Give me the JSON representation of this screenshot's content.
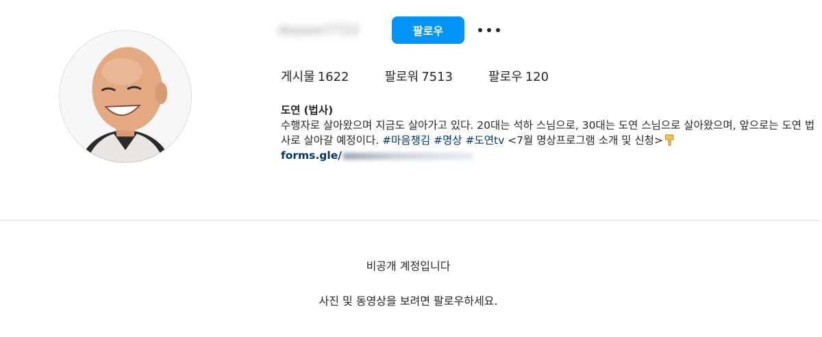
{
  "profile": {
    "username": "doyeon7722",
    "follow_label": "팔로우",
    "more_label": "..."
  },
  "stats": {
    "posts_label": "게시물",
    "posts_value": "1622",
    "followers_label": "팔로워",
    "followers_value": "7513",
    "following_label": "팔로우",
    "following_value": "120"
  },
  "bio": {
    "name": "도연",
    "name_suffix": "(법사)",
    "text_part1": "수행자로 살아왔으며 지금도 살아가고 있다. 20대는 석하 스님으로, 30대는 도연 스님으로 살아왔으며, 앞으로는 도연 법사로 살아갈 예정이다.",
    "hashtags": [
      "#마음챙김",
      "#명상",
      "#도연tv"
    ],
    "text_part2": "<7월 명상프로그램 소개 및 신청>",
    "link": "forms.gle/"
  },
  "private": {
    "title": "비공개 계정입니다",
    "subtitle": "사진 및 동영상을 보려면 팔로우하세요."
  },
  "colors": {
    "accent": "#0095f6",
    "link": "#00376b",
    "divider": "#dbdbdb"
  },
  "icons": {
    "more": "more-dots-icon",
    "pointer": "pointing-down-hand-icon"
  }
}
